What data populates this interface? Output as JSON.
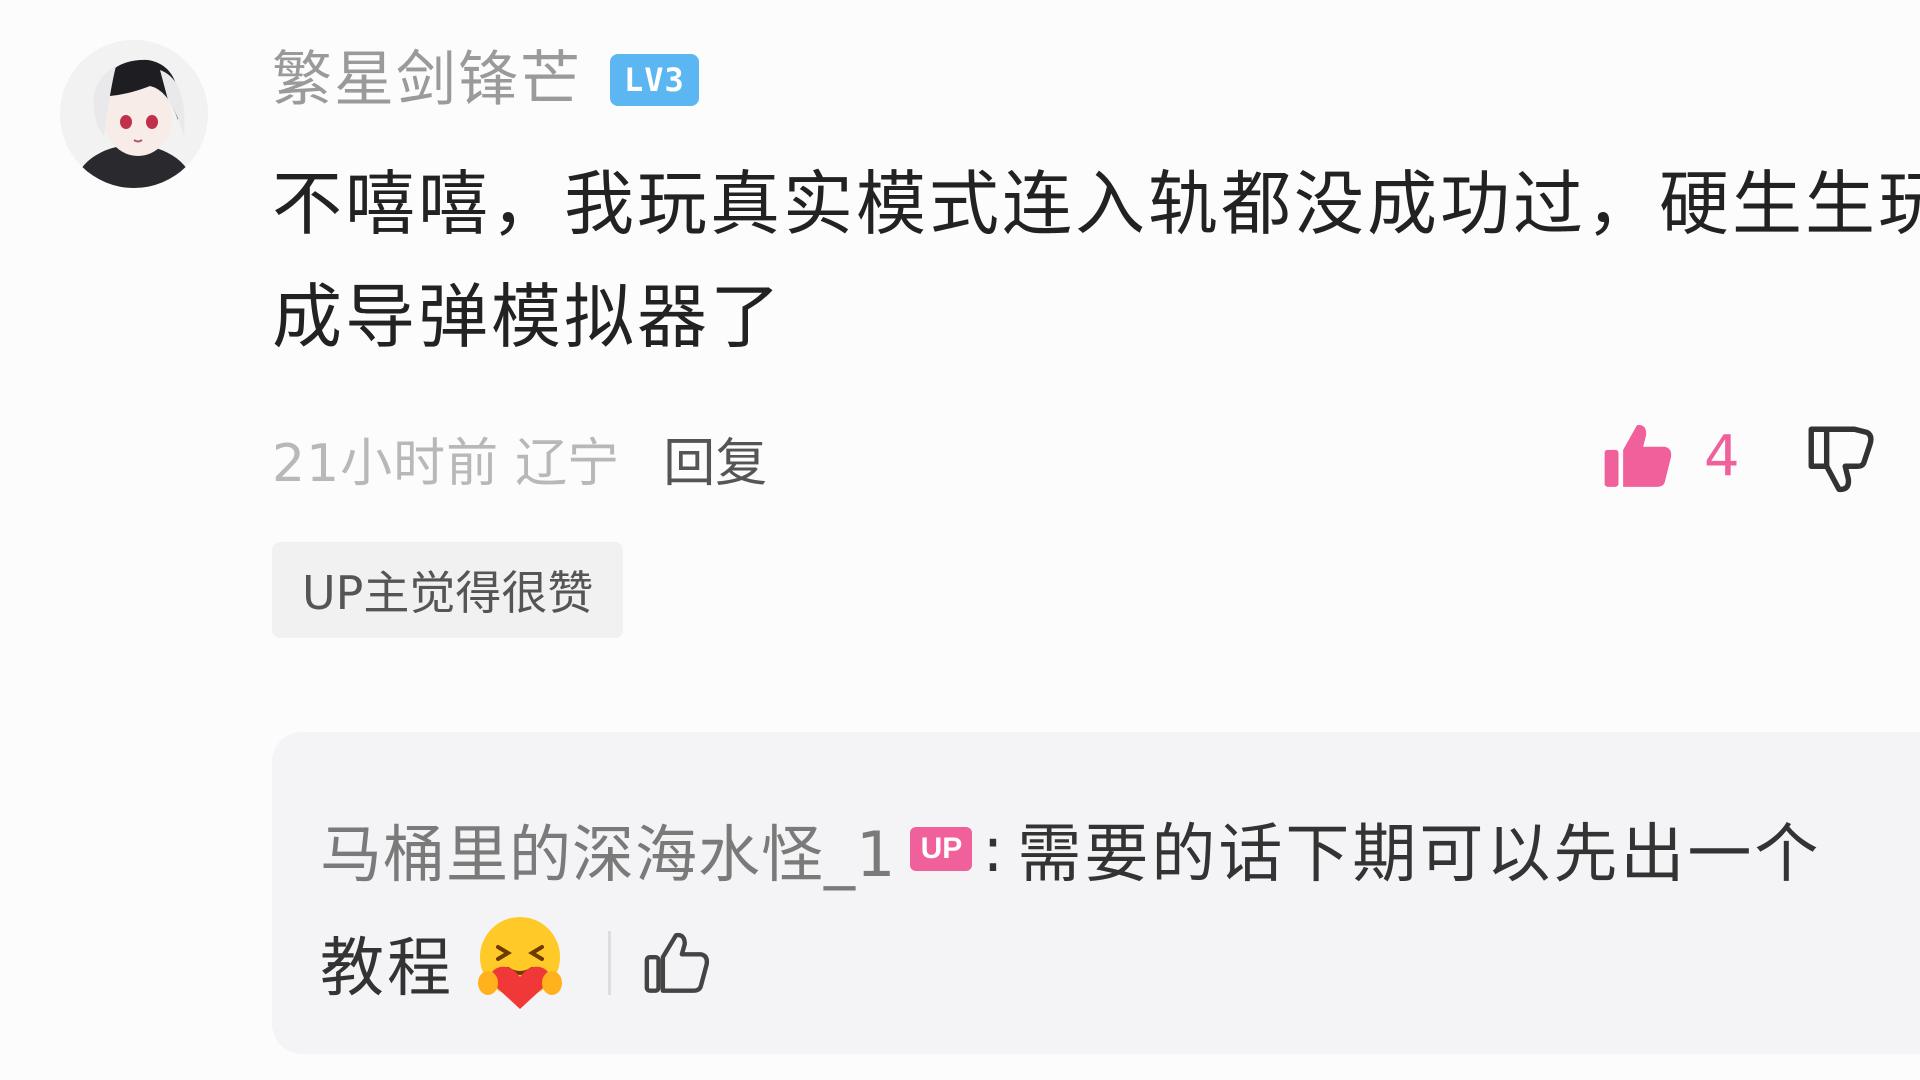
{
  "comment": {
    "username": "繁星剑锋芒",
    "level": "LV3",
    "text": "不嘻嘻，我玩真实模式连入轨都没成功过，硬生生玩成导弹模拟器了",
    "time": "21小时前",
    "location": "辽宁",
    "reply_label": "回复",
    "like_count": "4",
    "up_tag": "UP主觉得很赞"
  },
  "reply": {
    "author": "马桶里的深海水怪_1",
    "badge": "UP",
    "colon": ":",
    "text_line1": "需要的话下期可以先出一个",
    "text_line2": "教程",
    "emoji": "hug-emoji"
  },
  "colors": {
    "accent_pink": "#f0609a",
    "level_blue": "#5bb6f2"
  }
}
